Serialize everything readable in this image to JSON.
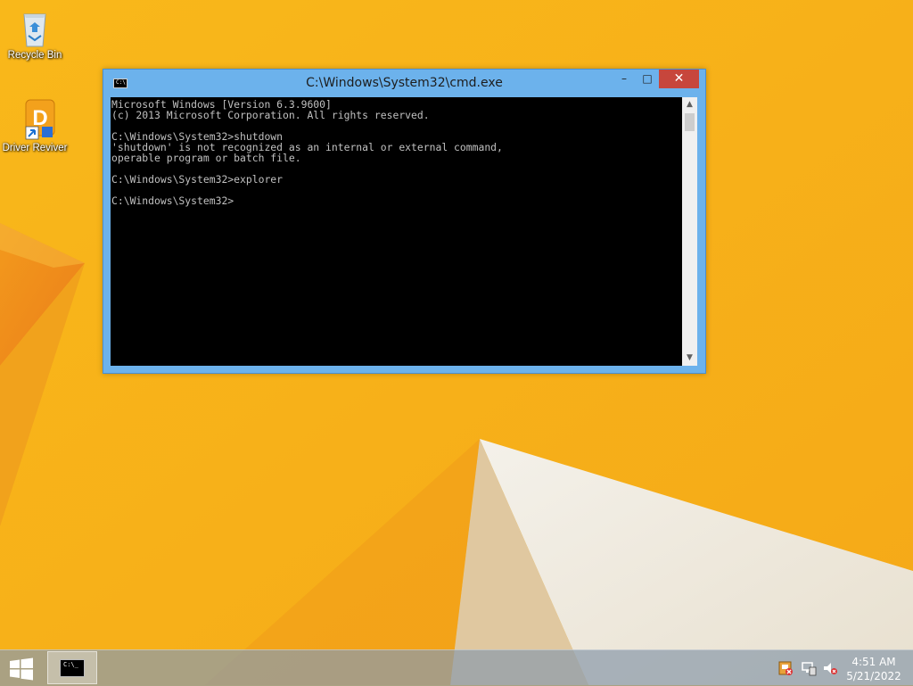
{
  "desktop": {
    "icons": [
      {
        "label": "Recycle Bin",
        "icon": "recycle-bin-icon"
      },
      {
        "label": "Driver Reviver",
        "icon": "driver-reviver-icon"
      }
    ]
  },
  "window": {
    "title": "C:\\Windows\\System32\\cmd.exe",
    "app_icon_text": "C:\\",
    "buttons": {
      "minimize": "–",
      "maximize": "□",
      "close": "✕"
    },
    "console_lines": [
      "Microsoft Windows [Version 6.3.9600]",
      "(c) 2013 Microsoft Corporation. All rights reserved.",
      "",
      "C:\\Windows\\System32>shutdown",
      "'shutdown' is not recognized as an internal or external command,",
      "operable program or batch file.",
      "",
      "C:\\Windows\\System32>explorer",
      "",
      "C:\\Windows\\System32>"
    ]
  },
  "taskbar": {
    "start_icon": "windows-logo-icon",
    "items": [
      {
        "icon": "command-prompt-icon",
        "thumb_text": "C:\\_"
      }
    ],
    "tray": [
      "action-center-flag-icon",
      "network-icon",
      "volume-muted-icon"
    ],
    "time": "4:51 AM",
    "date": "5/21/2022"
  },
  "colors": {
    "wallpaper": "#f7b21b",
    "title_bar": "#6cb2ec",
    "close_button": "#c7463c",
    "console_bg": "#000000",
    "console_text": "#c0c0c0"
  }
}
